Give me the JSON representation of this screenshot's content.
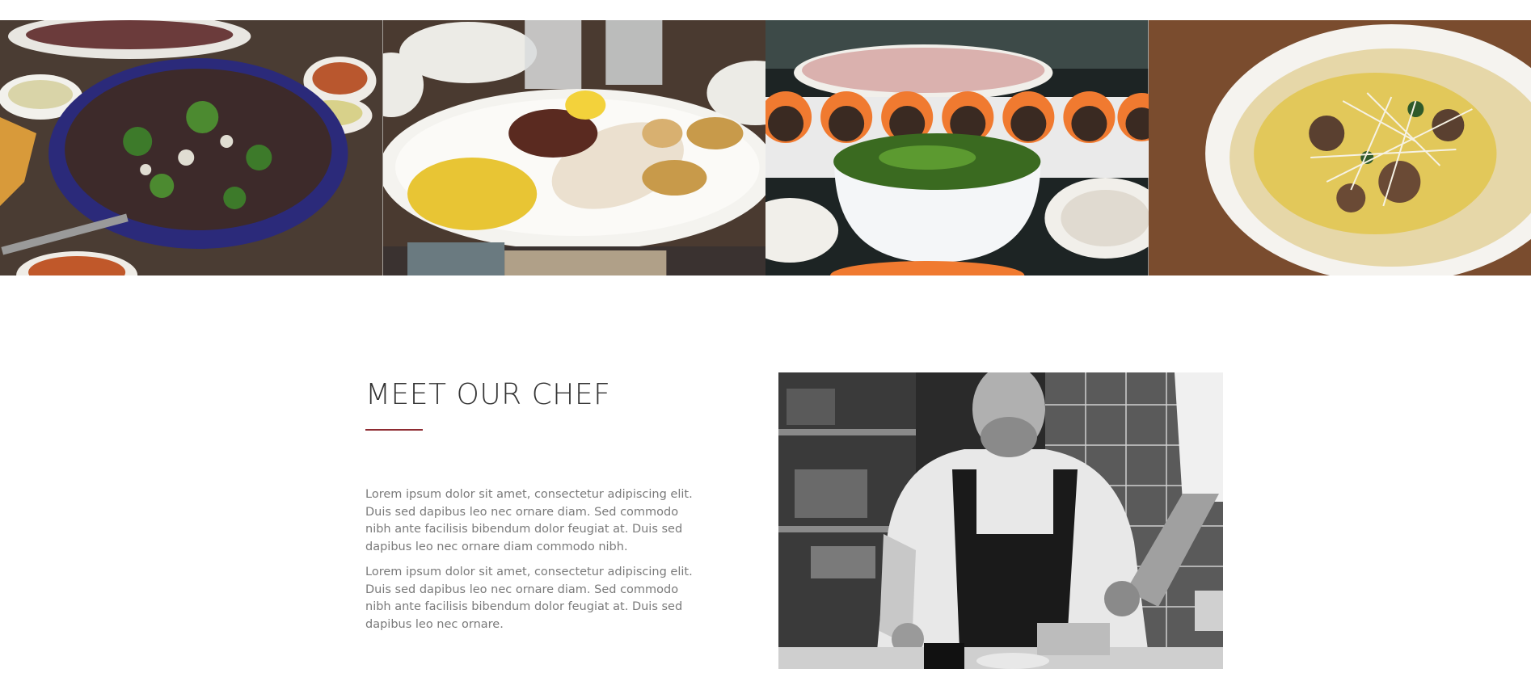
{
  "gallery": {
    "photos": [
      {
        "subject": "salad bowl"
      },
      {
        "subject": "grilled squid platter"
      },
      {
        "subject": "sushi and edamame"
      },
      {
        "subject": "pasta"
      }
    ]
  },
  "chef": {
    "title": "MEET OUR CHEF",
    "paragraph1": "Lorem ipsum dolor sit amet, consectetur adipiscing elit. Duis sed dapibus leo nec ornare diam. Sed commodo nibh ante facilisis bibendum dolor feugiat at. Duis sed dapibus leo nec ornare diam commodo nibh.",
    "paragraph2": "Lorem ipsum dolor sit amet, consectetur adipiscing elit. Duis sed dapibus leo nec ornare diam. Sed commodo nibh ante facilisis bibendum dolor feugiat at. Duis sed dapibus leo nec ornare.",
    "accent_color": "#8e2b32"
  }
}
